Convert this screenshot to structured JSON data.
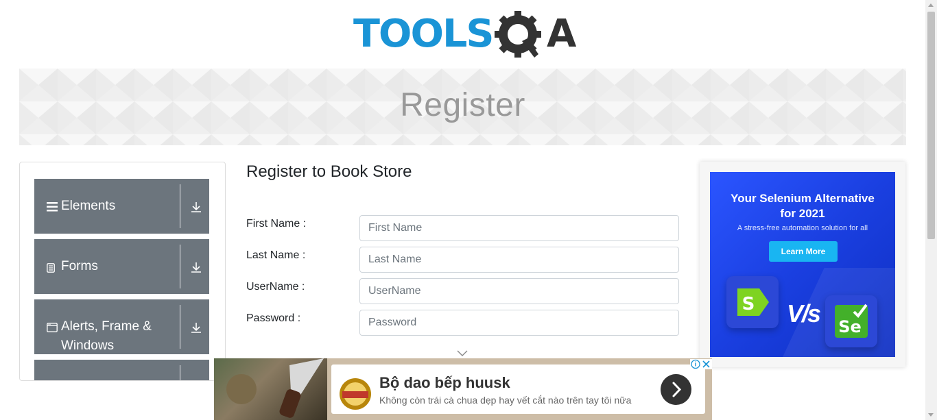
{
  "logo": {
    "tools": "TOOLS",
    "qa": "QA"
  },
  "banner": {
    "title": "Register"
  },
  "sidebar": {
    "groups": [
      {
        "label": "Elements",
        "icon": "hamburger-icon"
      },
      {
        "label": "Forms",
        "icon": "document-icon"
      },
      {
        "label": "Alerts, Frame & Windows",
        "icon": "window-icon"
      },
      {
        "label": "",
        "icon": ""
      }
    ]
  },
  "form": {
    "title": "Register to Book Store",
    "fields": [
      {
        "label": "First Name :",
        "placeholder": "First Name"
      },
      {
        "label": "Last Name :",
        "placeholder": "Last Name"
      },
      {
        "label": "UserName :",
        "placeholder": "UserName"
      },
      {
        "label": "Password :",
        "placeholder": "Password"
      }
    ]
  },
  "right_ad": {
    "headline_1": "Your Selenium Alternative",
    "headline_2": "for 2021",
    "subline": "A stress-free automation solution for all",
    "button": "Learn More",
    "vs": "V/s"
  },
  "bottom_ad": {
    "title": "Bộ dao bếp huusk",
    "subtitle": "Không còn trái cà chua dẹp hay vết cắt nào trên tay tôi nữa"
  },
  "colors": {
    "logo_blue": "#1a94d6",
    "logo_dark": "#333333",
    "sidebar_group": "#6c757d",
    "ad_blue": "#1a3fe0",
    "ad_button": "#19b5f2"
  }
}
